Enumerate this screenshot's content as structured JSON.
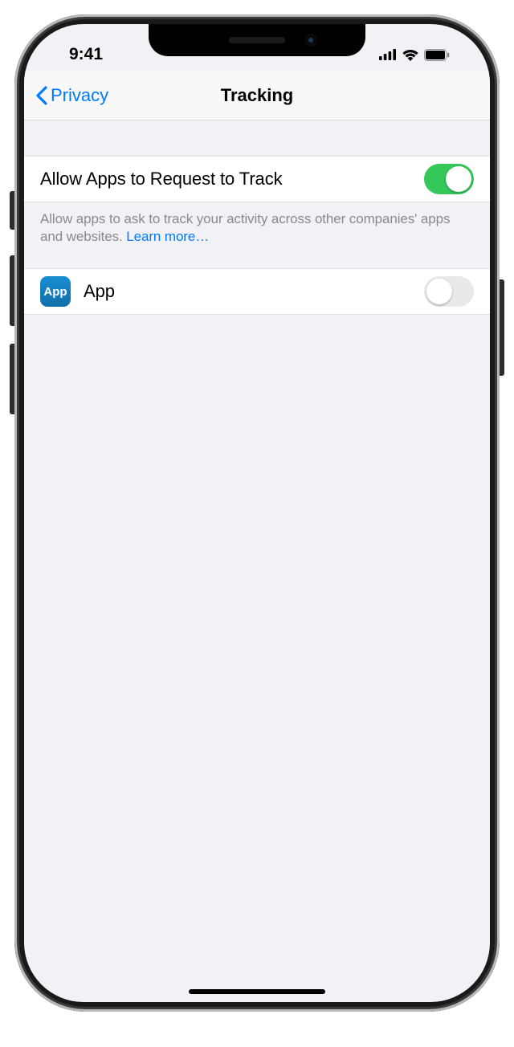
{
  "statusbar": {
    "time": "9:41"
  },
  "nav": {
    "back_label": "Privacy",
    "title": "Tracking"
  },
  "settings": {
    "allow_label": "Allow Apps to Request to Track",
    "allow_on": true,
    "footer_text": "Allow apps to ask to track your activity across other companies' apps and websites. ",
    "learn_more": "Learn more…"
  },
  "apps": [
    {
      "name": "App",
      "icon_text": "App",
      "toggle_on": false
    }
  ]
}
